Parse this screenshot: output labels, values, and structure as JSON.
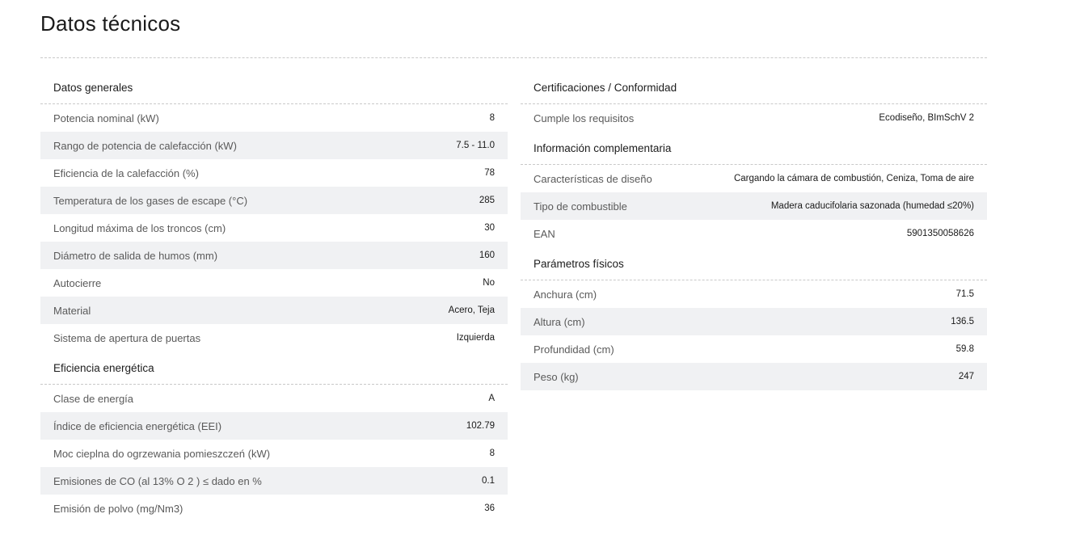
{
  "title": "Datos técnicos",
  "left": {
    "general": {
      "heading": "Datos generales",
      "rows": [
        {
          "label": "Potencia nominal (kW)",
          "value": "8"
        },
        {
          "label": "Rango de potencia de calefacción (kW)",
          "value": "7.5 - 11.0"
        },
        {
          "label": "Eficiencia de la calefacción (%)",
          "value": "78"
        },
        {
          "label": "Temperatura de los gases de escape (°C)",
          "value": "285"
        },
        {
          "label": "Longitud máxima de los troncos (cm)",
          "value": "30"
        },
        {
          "label": "Diámetro de salida de humos (mm)",
          "value": "160"
        },
        {
          "label": "Autocierre",
          "value": "No"
        },
        {
          "label": "Material",
          "value": "Acero, Teja"
        },
        {
          "label": "Sistema de apertura de puertas",
          "value": "Izquierda"
        }
      ]
    },
    "energy": {
      "heading": "Eficiencia energética",
      "rows": [
        {
          "label": "Clase de energía",
          "value": "A"
        },
        {
          "label": "Índice de eficiencia energética (EEI)",
          "value": "102.79"
        },
        {
          "label": "Moc cieplna do ogrzewania pomieszczeń (kW)",
          "value": "8"
        },
        {
          "label": "Emisiones de CO (al 13% O 2 ) ≤ dado en %",
          "value": "0.1"
        },
        {
          "label": "Emisión de polvo (mg/Nm3)",
          "value": "36"
        }
      ]
    }
  },
  "right": {
    "cert": {
      "heading": "Certificaciones / Conformidad",
      "rows": [
        {
          "label": "Cumple los requisitos",
          "value": "Ecodiseño, BImSchV 2"
        }
      ]
    },
    "info": {
      "heading": "Información complementaria",
      "rows": [
        {
          "label": "Características de diseño",
          "value": "Cargando la cámara de combustión, Ceniza, Toma de aire"
        },
        {
          "label": "Tipo de combustible",
          "value": "Madera caducifolaria sazonada (humedad ≤20%)"
        },
        {
          "label": "EAN",
          "value": "5901350058626"
        }
      ]
    },
    "physical": {
      "heading": "Parámetros físicos",
      "rows": [
        {
          "label": "Anchura (cm)",
          "value": "71.5"
        },
        {
          "label": "Altura (cm)",
          "value": "136.5"
        },
        {
          "label": "Profundidad (cm)",
          "value": "59.8"
        },
        {
          "label": "Peso (kg)",
          "value": "247"
        }
      ]
    }
  }
}
